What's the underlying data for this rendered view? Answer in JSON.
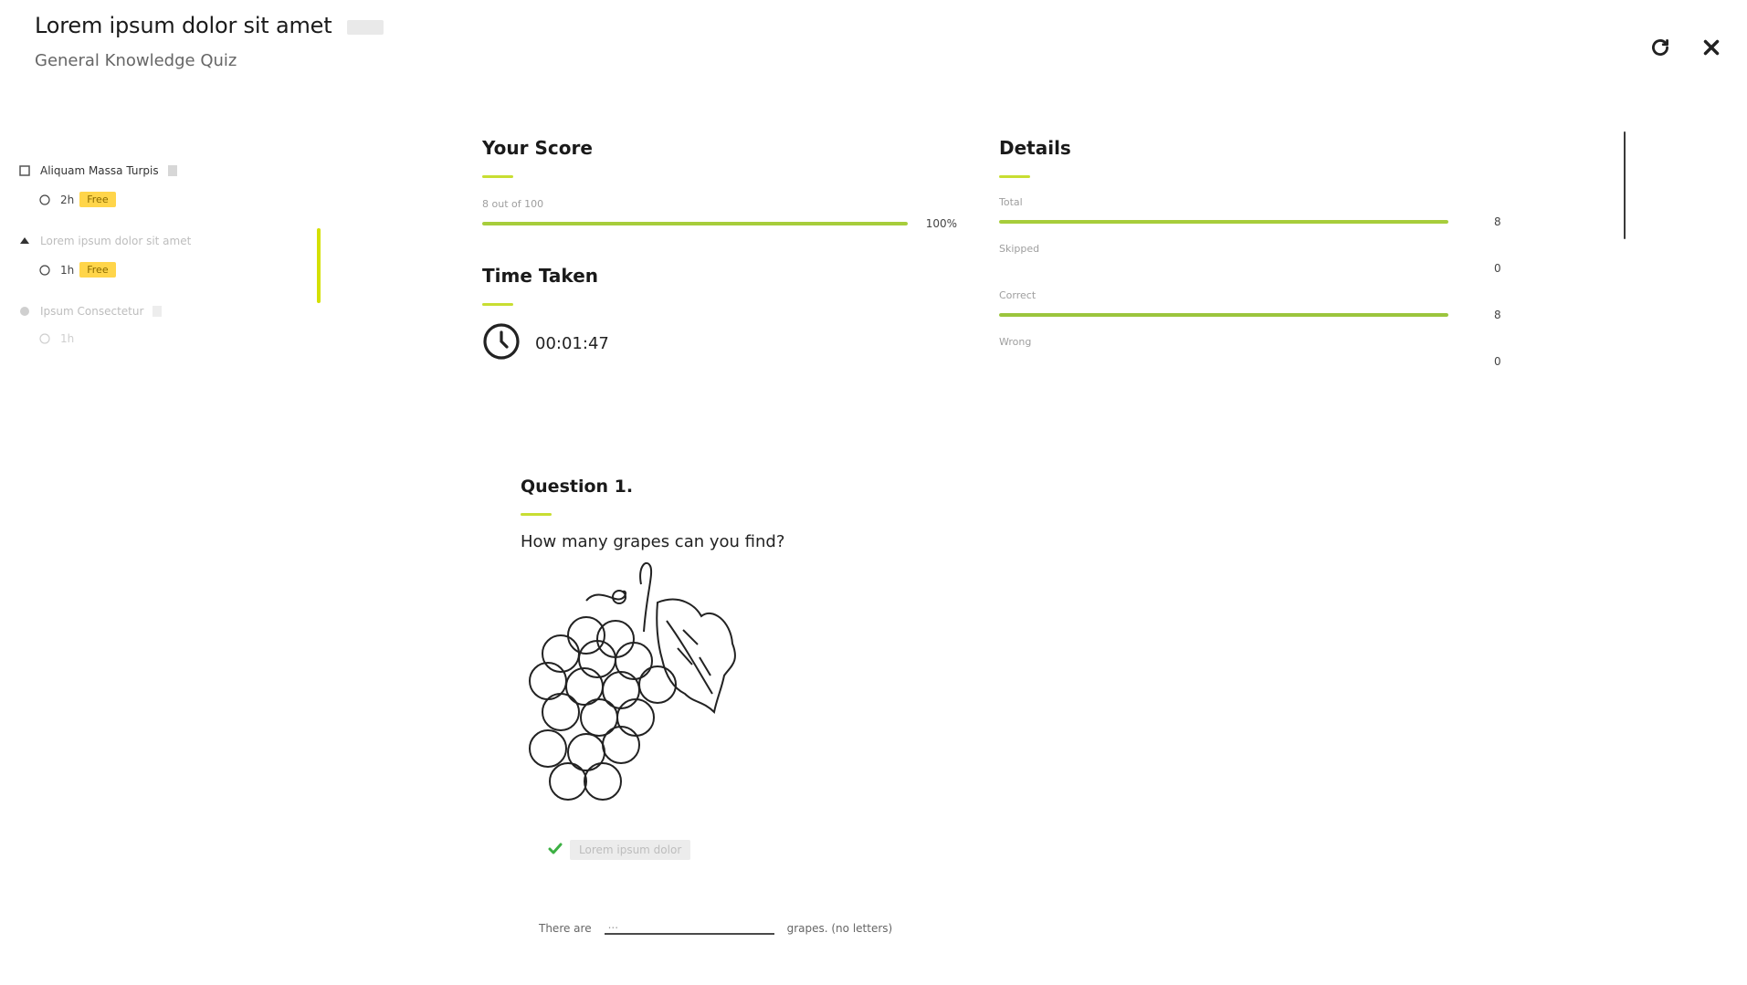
{
  "header": {
    "title": "Lorem ipsum dolor sit amet",
    "subtitle": "General Knowledge Quiz",
    "actions": [
      {
        "name": "refresh-icon"
      },
      {
        "name": "close-icon"
      }
    ]
  },
  "sidebar": {
    "sections": [
      {
        "label": "Aliquam Massa Turpis",
        "item": {
          "number": "2h",
          "tag": "Free"
        }
      },
      {
        "label": "Lorem ipsum dolor sit amet",
        "item": {
          "number": "1h",
          "tag": "Free"
        }
      },
      {
        "label": "Ipsum Consectetur",
        "item": {
          "number": "1h",
          "tag": ""
        }
      }
    ]
  },
  "score": {
    "title": "Your Score",
    "label": "8 out of 100",
    "percent_text": "100%",
    "fill": 1.0
  },
  "time": {
    "title": "Time Taken",
    "value": "00:01:47"
  },
  "details": {
    "title": "Details",
    "rows": [
      {
        "label": "Total",
        "value": "8",
        "fill": 1.0
      },
      {
        "label": "Skipped",
        "value": "0",
        "fill": 0.0
      },
      {
        "label": "Correct",
        "value": "8",
        "fill": 1.0
      },
      {
        "label": "Wrong",
        "value": "0",
        "fill": 0.0
      }
    ]
  },
  "question": {
    "title": "Question 1.",
    "text": "How many grapes can you find?",
    "answer_text": "Lorem ipsum dolor",
    "fill_prefix": "There are",
    "fill_value": "...",
    "fill_suffix": "grapes. (no letters)"
  },
  "colors": {
    "accent": "#c8de32",
    "bar": "#a7cd3b",
    "pill": "#ffd54a"
  }
}
